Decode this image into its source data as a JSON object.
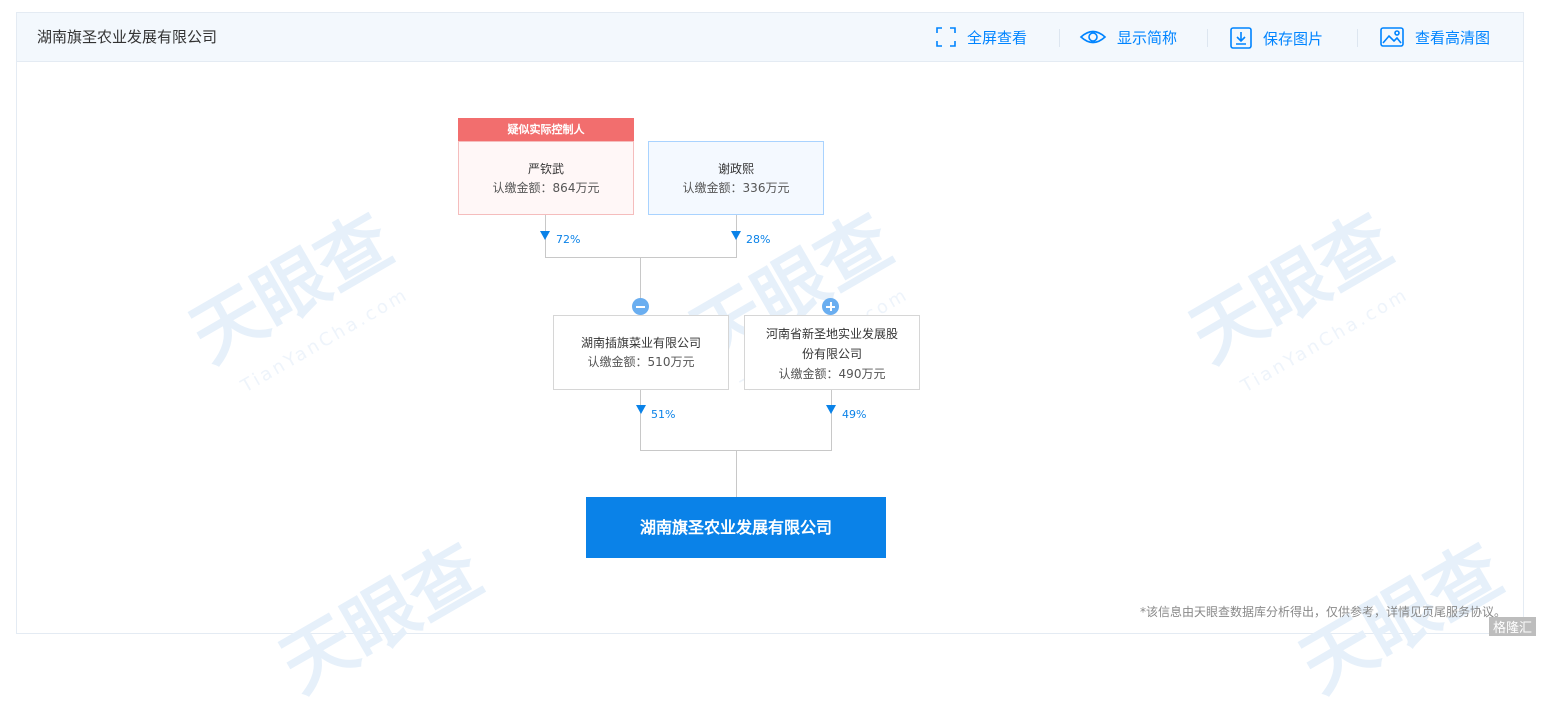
{
  "header": {
    "company_name": "湖南旗圣农业发展有限公司",
    "tools": {
      "fullscreen": "全屏查看",
      "show_short": "显示简称",
      "save_image": "保存图片",
      "hd_image": "查看高清图"
    }
  },
  "watermark": {
    "brand": "天眼查",
    "domain": "TianYanCha.com"
  },
  "diagram": {
    "controller_badge": "疑似实际控制人",
    "shareholders": [
      {
        "name": "严钦武",
        "amount": "认缴金额：864万元",
        "percent": "72%"
      },
      {
        "name": "谢政熙",
        "amount": "认缴金额：336万元",
        "percent": "28%"
      }
    ],
    "intermediate": [
      {
        "name": "湖南插旗菜业有限公司",
        "amount": "认缴金额：510万元",
        "percent": "51%",
        "toggle": "collapse"
      },
      {
        "name_line1": "河南省新圣地实业发展股",
        "name_line2": "份有限公司",
        "amount": "认缴金额：490万元",
        "percent": "49%",
        "toggle": "expand"
      }
    ],
    "target": "湖南旗圣农业发展有限公司"
  },
  "footer": {
    "note": "*该信息由天眼查数据库分析得出，仅供参考，详情见页尾服务协议。",
    "logo": "格隆汇"
  },
  "colors": {
    "accent": "#0a82e8",
    "badge": "#f26e6e"
  }
}
